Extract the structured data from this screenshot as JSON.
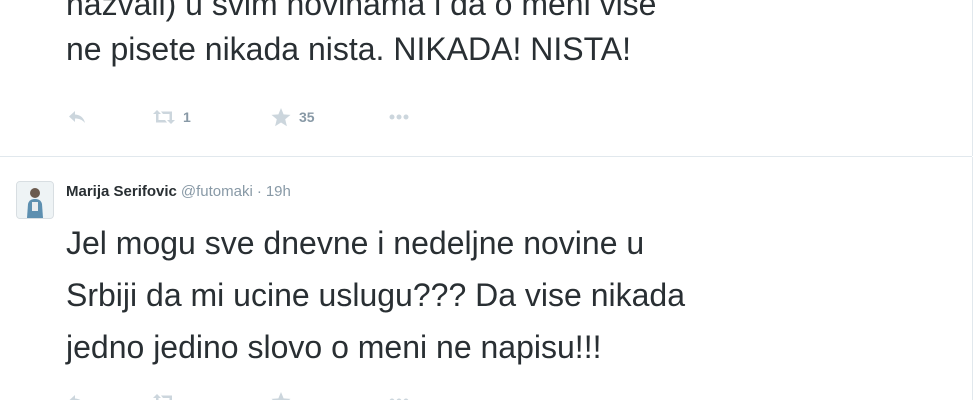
{
  "top_tweet": {
    "text_line1": "nazvali) u svim novinama i da o meni vise",
    "text_line2": "ne pisete nikada nista. NIKADA! NISTA!",
    "retweet_count": "1",
    "favorite_count": "35"
  },
  "main_tweet": {
    "fullname": "Marija Serifovic",
    "handle": "@futomaki",
    "separator": "·",
    "time": "19h",
    "text_line1": "Jel mogu sve dnevne i nedeljne novine u",
    "text_line2": "Srbiji da mi ucine uslugu??? Da vise nikada",
    "text_line3": "jedno jedino slovo o meni ne napisu!!!"
  },
  "icons": {
    "reply": "reply-icon",
    "retweet": "retweet-icon",
    "favorite": "star-icon",
    "more": "more-icon"
  },
  "colors": {
    "text": "#292f33",
    "muted": "#8899a6",
    "icon": "#ccd6dd",
    "border": "#e1e8ed"
  }
}
